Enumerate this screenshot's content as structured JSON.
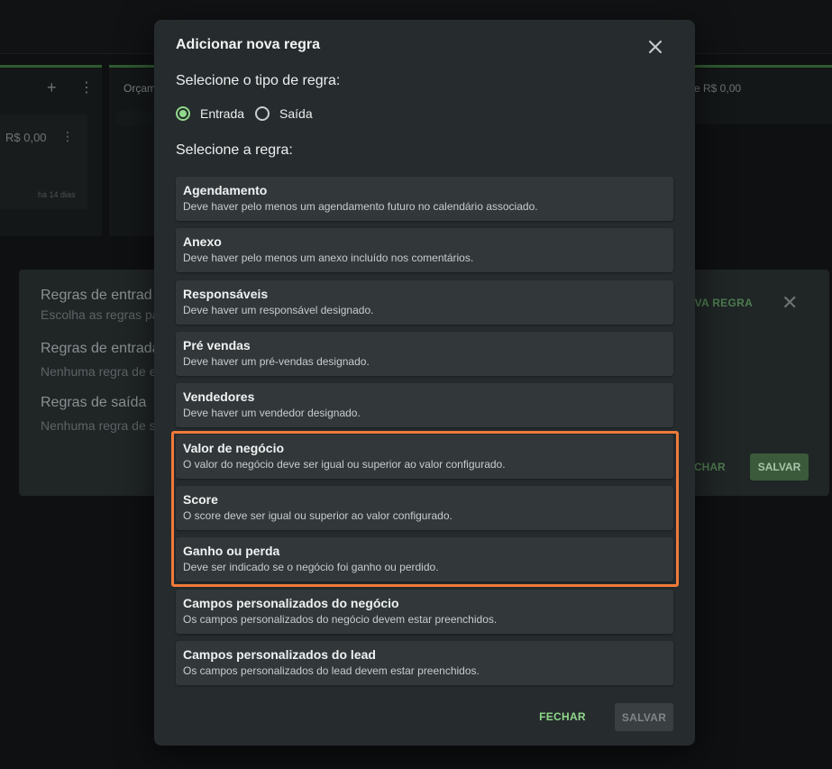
{
  "background": {
    "col1_plus": "+",
    "col1_more": "⋮",
    "col2_title": "Orçam",
    "col3_title": "e R$ 0,00",
    "card_price": "R$ 0,00",
    "card_more": "⋮",
    "card_date": "há 14 dias",
    "rules_panel": {
      "title1": "Regras de entrad",
      "sub1": "Escolha as regras pa",
      "title2": "Regras de entrada",
      "sub2": "Nenhuma regra de e",
      "title3": "Regras de saída",
      "sub3": "Nenhuma regra de s",
      "nova_regra": "OVA REGRA",
      "fechar": "CHAR",
      "salvar": "SALVAR"
    }
  },
  "modal": {
    "title": "Adicionar nova regra",
    "type_label": "Selecione o tipo de regra:",
    "types": [
      {
        "label": "Entrada",
        "selected": true
      },
      {
        "label": "Saída",
        "selected": false
      }
    ],
    "rule_label": "Selecione a regra:",
    "rules": [
      {
        "name": "Agendamento",
        "desc": "Deve haver pelo menos um agendamento futuro no calendário associado."
      },
      {
        "name": "Anexo",
        "desc": "Deve haver pelo menos um anexo incluído nos comentários."
      },
      {
        "name": "Responsáveis",
        "desc": "Deve haver um responsável designado."
      },
      {
        "name": "Pré vendas",
        "desc": "Deve haver um pré-vendas designado."
      },
      {
        "name": "Vendedores",
        "desc": "Deve haver um vendedor designado."
      },
      {
        "name": "Valor de negócio",
        "desc": "O valor do negócio deve ser igual ou superior ao valor configurado."
      },
      {
        "name": "Score",
        "desc": "O score deve ser igual ou superior ao valor configurado."
      },
      {
        "name": "Ganho ou perda",
        "desc": "Deve ser indicado se o negócio foi ganho ou perdido."
      },
      {
        "name": "Campos personalizados do negócio",
        "desc": "Os campos personalizados do negócio devem estar preenchidos."
      },
      {
        "name": "Campos personalizados do lead",
        "desc": "Os campos personalizados do lead devem estar preenchidos."
      }
    ],
    "fechar_label": "FECHAR",
    "salvar_label": "SALVAR"
  },
  "colors": {
    "accent_green": "#8fd98a",
    "highlight_orange": "#f07a3a",
    "modal_bg": "#262b2d",
    "rule_bg": "#32383a"
  }
}
